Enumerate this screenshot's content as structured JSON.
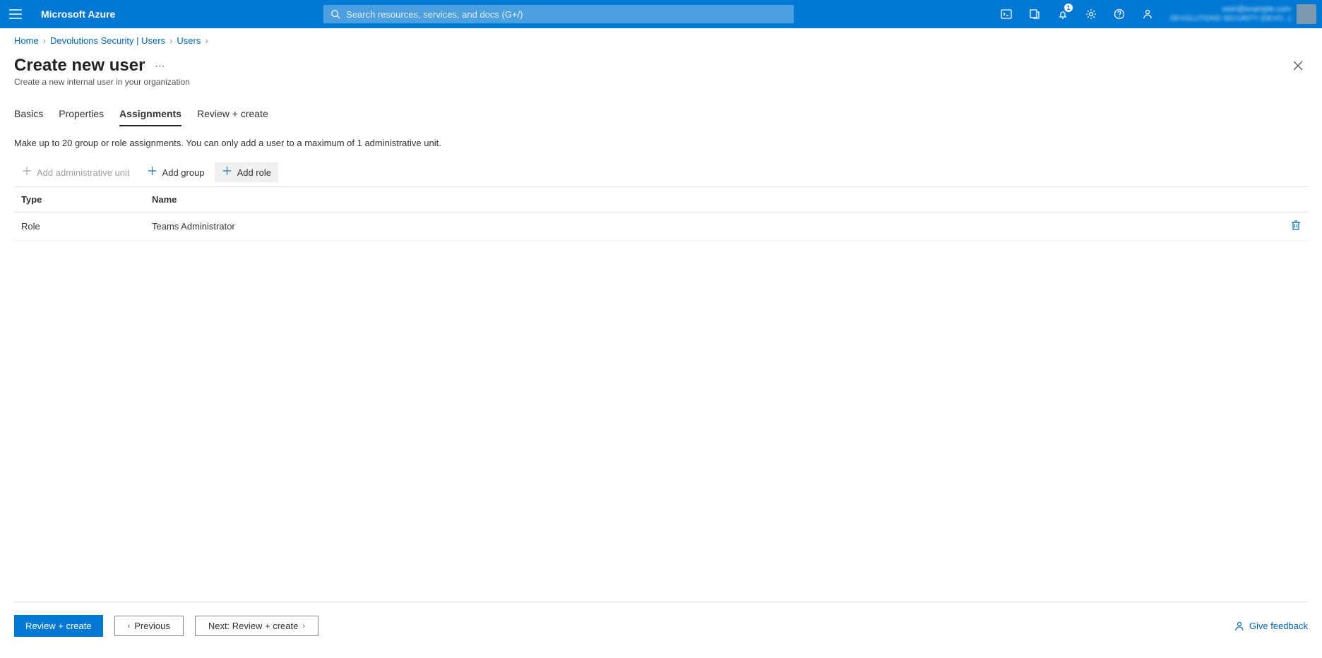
{
  "topbar": {
    "brand": "Microsoft Azure",
    "search_placeholder": "Search resources, services, and docs (G+/)",
    "notification_count": "1",
    "account_line1": "user@example.com",
    "account_line2": "DEVOLUTIONS SECURITY (DEVO...)"
  },
  "breadcrumb": {
    "items": [
      "Home",
      "Devolutions Security | Users",
      "Users"
    ]
  },
  "page": {
    "title": "Create new user",
    "subtitle": "Create a new internal user in your organization"
  },
  "tabs": {
    "basics": "Basics",
    "properties": "Properties",
    "assignments": "Assignments",
    "review": "Review + create"
  },
  "intro": "Make up to 20 group or role assignments. You can only add a user to a maximum of 1 administrative unit.",
  "actions": {
    "add_admin_unit": "Add administrative unit",
    "add_group": "Add group",
    "add_role": "Add role"
  },
  "table": {
    "headers": {
      "type": "Type",
      "name": "Name"
    },
    "rows": [
      {
        "type": "Role",
        "name": "Teams Administrator"
      }
    ]
  },
  "footer": {
    "review_create": "Review + create",
    "previous": "Previous",
    "next": "Next: Review + create",
    "feedback": "Give feedback"
  }
}
